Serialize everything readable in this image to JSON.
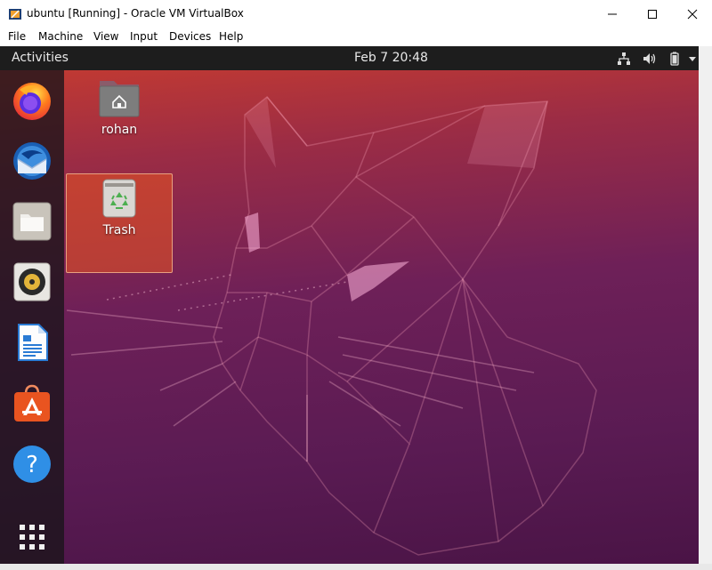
{
  "window": {
    "title": "ubuntu [Running] - Oracle VM VirtualBox",
    "menu": [
      "File",
      "Machine",
      "View",
      "Input",
      "Devices",
      "Help"
    ]
  },
  "topbar": {
    "activities": "Activities",
    "clock": "Feb 7  20:48"
  },
  "dock": {
    "items": [
      {
        "name": "firefox-icon"
      },
      {
        "name": "thunderbird-icon"
      },
      {
        "name": "files-icon"
      },
      {
        "name": "rhythmbox-icon"
      },
      {
        "name": "libreoffice-writer-icon"
      },
      {
        "name": "ubuntu-software-icon"
      },
      {
        "name": "help-icon"
      },
      {
        "name": "show-applications-icon"
      }
    ]
  },
  "desktop": {
    "icons": [
      {
        "label": "rohan"
      },
      {
        "label": "Trash"
      }
    ]
  },
  "colors": {
    "ubuntu_orange": "#E95420",
    "topbar": "#1D1D1D"
  }
}
